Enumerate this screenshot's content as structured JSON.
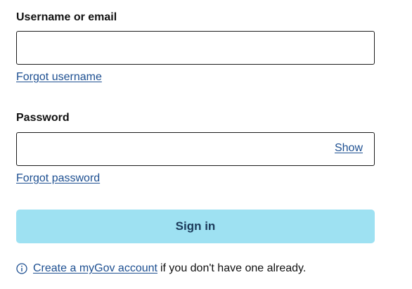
{
  "username": {
    "label": "Username or email",
    "value": "",
    "placeholder": "",
    "forgot_link": "Forgot username"
  },
  "password": {
    "label": "Password",
    "value": "",
    "placeholder": "",
    "show_label": "Show",
    "forgot_link": "Forgot password"
  },
  "signin": {
    "label": "Sign in"
  },
  "footer": {
    "icon": "info-icon",
    "link_text": "Create a myGov account",
    "suffix_text": "if you don't have one already."
  },
  "colors": {
    "link": "#1d4f91",
    "button_bg": "#9ee1f2",
    "button_text": "#1b3a5a",
    "border": "#1b1b1b"
  }
}
